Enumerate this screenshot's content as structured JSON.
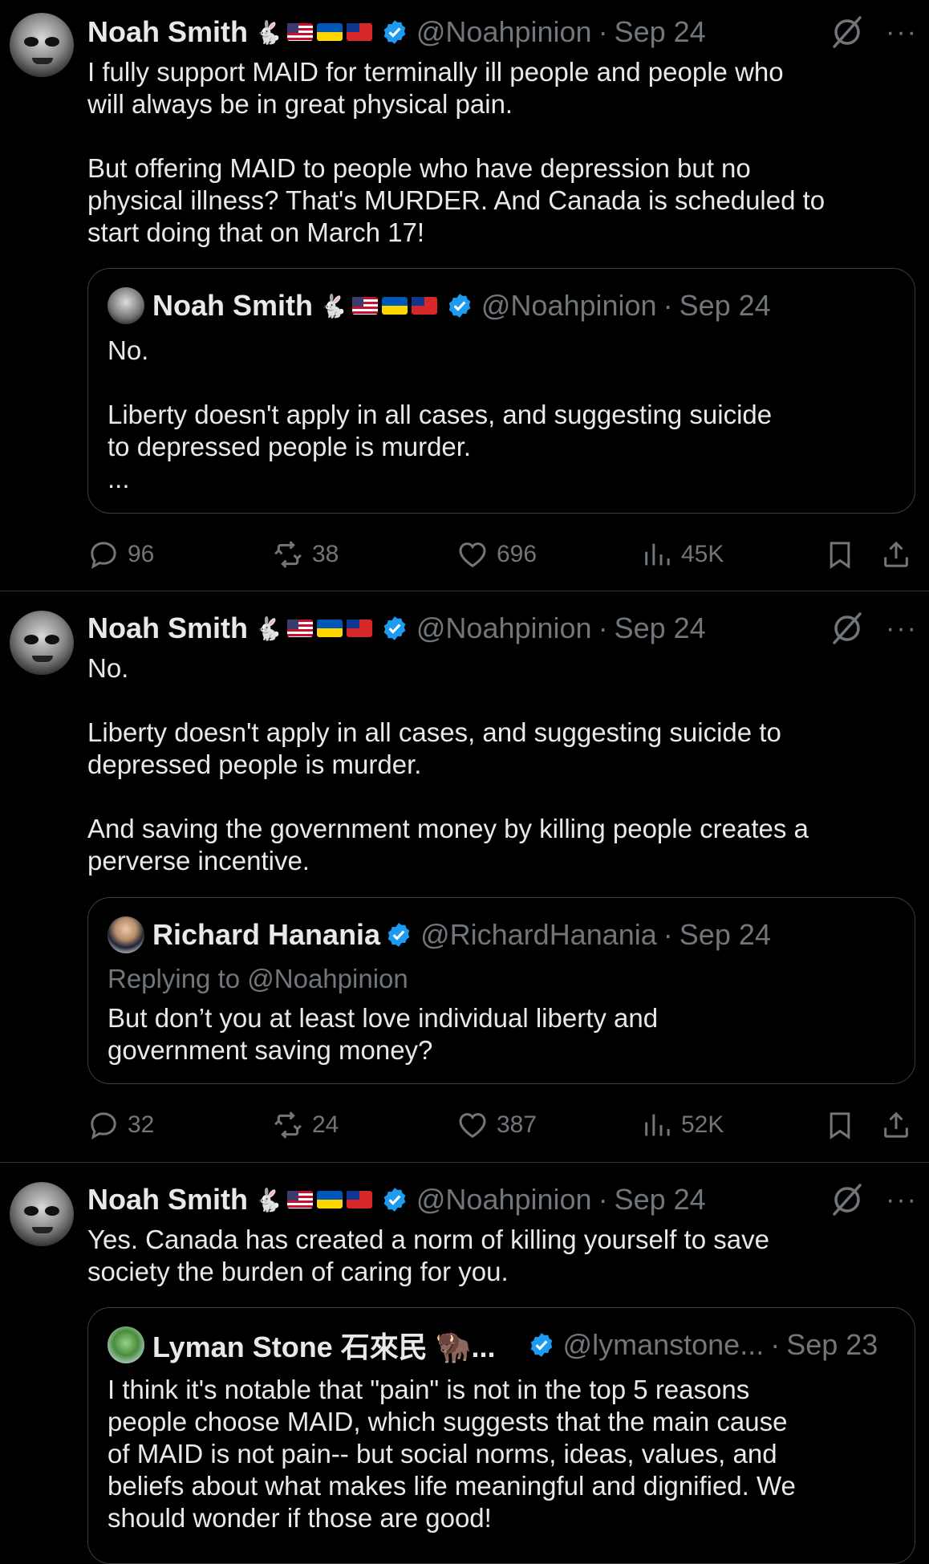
{
  "tweets": [
    {
      "author": "Noah Smith",
      "emoji_suffix": "🐇",
      "handle": "@Noahpinion",
      "date": "Sep 24",
      "text": "I fully support MAID for terminally ill people and people who\nwill always be in great physical pain.\n\nBut offering MAID to people who have depression but no\nphysical illness? That's MURDER. And Canada is scheduled to\nstart doing that on March 17!",
      "quote": {
        "author": "Noah Smith",
        "emoji_suffix": "🐇",
        "handle": "@Noahpinion",
        "date": "Sep 24",
        "text": "No.\n\nLiberty doesn't apply in all cases, and suggesting suicide\nto depressed people is murder.\n..."
      },
      "replies": "96",
      "reposts": "38",
      "likes": "696",
      "views": "45K"
    },
    {
      "author": "Noah Smith",
      "emoji_suffix": "🐇",
      "handle": "@Noahpinion",
      "date": "Sep 24",
      "text": "No.\n\nLiberty doesn't apply in all cases, and suggesting suicide to\ndepressed people is murder.\n\nAnd saving the government money by killing people creates a\nperverse incentive.",
      "quote": {
        "author": "Richard Hanania",
        "handle": "@RichardHanania",
        "date": "Sep 24",
        "replying_to": "Replying to @Noahpinion",
        "text": "But don’t you at least love individual liberty and\ngovernment saving money?"
      },
      "replies": "32",
      "reposts": "24",
      "likes": "387",
      "views": "52K"
    },
    {
      "author": "Noah Smith",
      "emoji_suffix": "🐇",
      "handle": "@Noahpinion",
      "date": "Sep 24",
      "text": "Yes. Canada has created a norm of killing yourself to save\nsociety the burden of caring for you.",
      "quote": {
        "author": "Lyman Stone 石來民 🦬...",
        "handle": "@lymanstone...",
        "date": "Sep 23",
        "text": "I think it's notable that \"pain\" is not in the top 5 reasons\npeople choose MAID, which suggests that the main cause\nof MAID is not pain-- but social norms, ideas, values, and\nbeliefs about what makes life meaningful and dignified. We\nshould wonder if those are good!"
      }
    }
  ],
  "separator": "·",
  "more_glyph": "···",
  "colors": {
    "verified": "#1d9bf0",
    "muted": "#71767b",
    "text": "#e7e9ea",
    "background": "#000000"
  },
  "icons": [
    "reply-icon",
    "repost-icon",
    "like-icon",
    "views-icon",
    "bookmark-icon",
    "share-icon",
    "grok-icon",
    "more-icon",
    "verified-badge-icon"
  ]
}
